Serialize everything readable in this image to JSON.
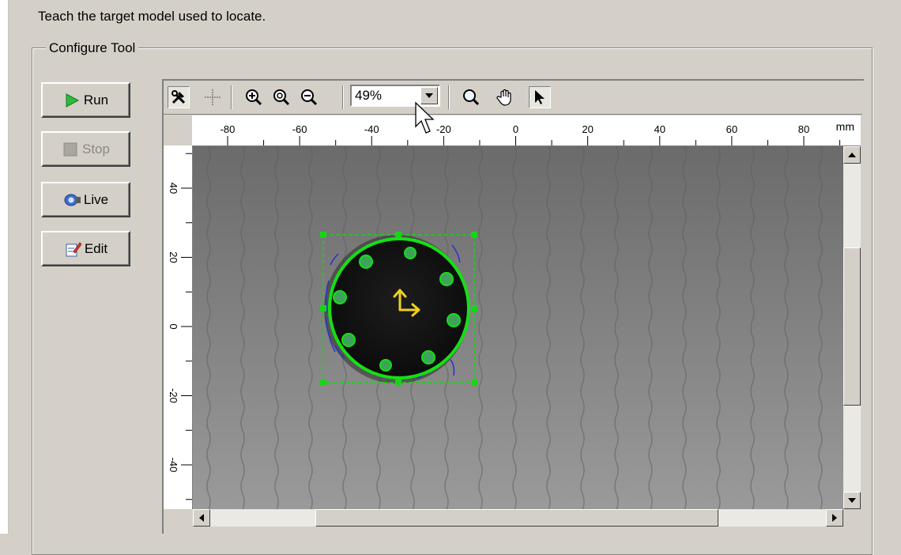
{
  "instruction": "Teach the target model used to locate.",
  "group_title": "Configure Tool",
  "buttons": {
    "run": "Run",
    "stop": "Stop",
    "live": "Live",
    "edit": "Edit"
  },
  "toolbar": {
    "zoom_value": "49%",
    "icons": [
      "tools-icon",
      "crosshair-icon",
      "zoom-in-icon",
      "zoom-fit-icon",
      "zoom-out-icon",
      "magnifier-icon",
      "pan-hand-icon",
      "pointer-icon"
    ]
  },
  "ruler": {
    "unit": "mm",
    "h_labels": [
      "-80",
      "-60",
      "-40",
      "-20",
      "0",
      "20",
      "40",
      "60",
      "80"
    ],
    "v_labels": [
      "40",
      "20",
      "0",
      "-20",
      "-40"
    ]
  },
  "colors": {
    "outline": "#14e014",
    "handle": "#18d418",
    "origin_arrow": "#f0d020",
    "edges": "#2a32c8"
  }
}
